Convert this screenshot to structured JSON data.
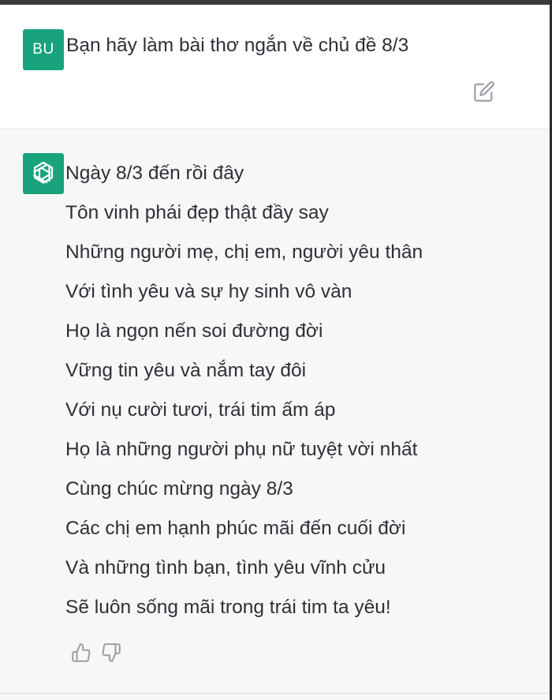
{
  "conversation": {
    "user_message": {
      "avatar_initials": "BU",
      "text": "Bạn hãy làm bài thơ ngắn về chủ đề 8/3"
    },
    "assistant_message": {
      "lines": [
        "Ngày 8/3 đến rồi đây",
        "Tôn vinh phái đẹp thật đầy say",
        "Những người mẹ, chị em, người yêu thân",
        "Với tình yêu và sự hy sinh vô vàn",
        "Họ là ngọn nến soi đường đời",
        "Vững tin yêu và nắm tay đôi",
        "Với nụ cười tươi, trái tim ấm áp",
        "Họ là những người phụ nữ tuyệt vời nhất",
        "Cùng chúc mừng ngày 8/3",
        "Các chị em hạnh phúc mãi đến cuối đời",
        "Và những tình bạn, tình yêu vĩnh cửu",
        "Sẽ luôn sống mãi trong trái tim ta yêu!"
      ]
    }
  },
  "icons": {
    "edit": "edit-icon",
    "assistant_logo": "openai-logo-icon",
    "thumbs_up": "thumbs-up-icon",
    "thumbs_down": "thumbs-down-icon"
  },
  "colors": {
    "avatar_bg": "#19a37d",
    "assistant_bg": "#f7f7f8",
    "text": "#2f2f36",
    "icon": "#9a9aa4"
  }
}
